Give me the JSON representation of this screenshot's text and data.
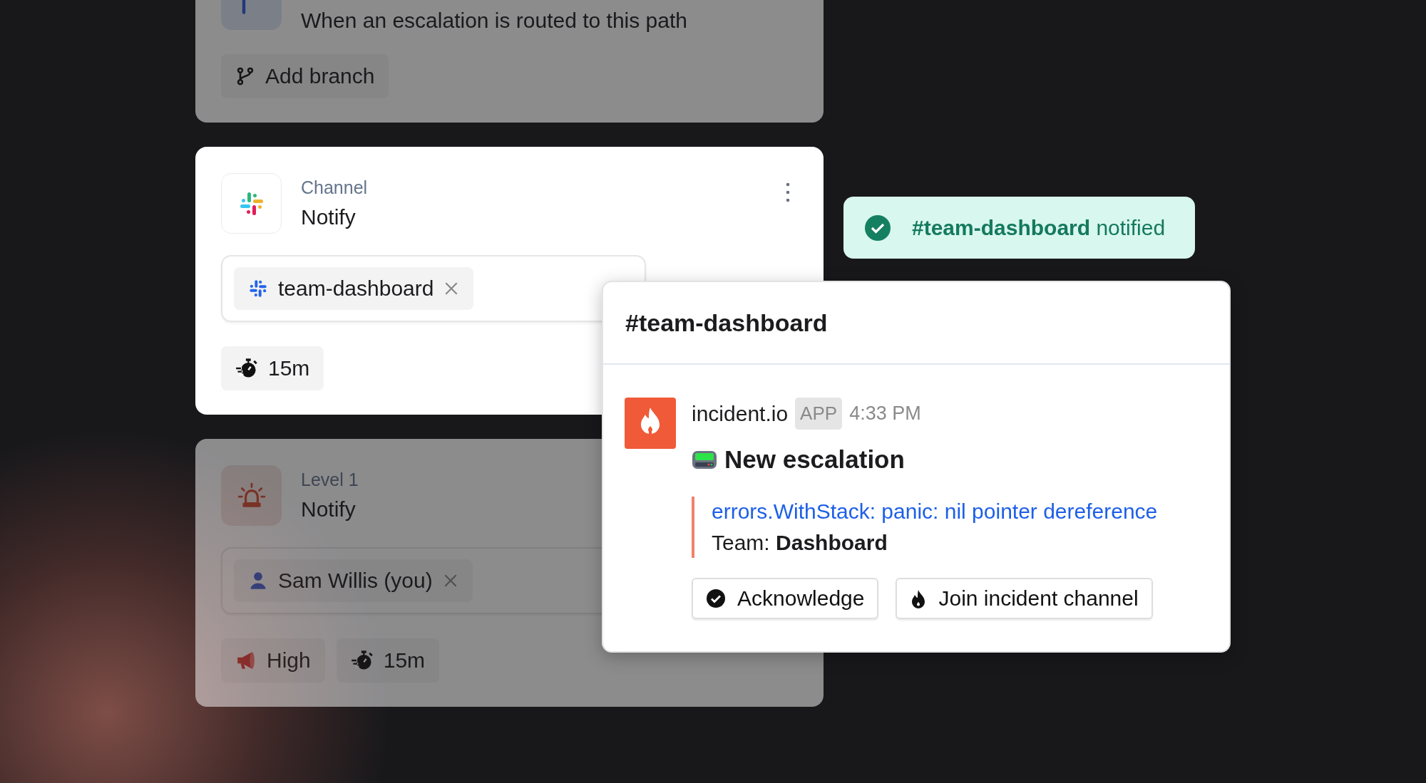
{
  "cards": [
    {
      "kind": "trigger",
      "dimmed": true,
      "title": "When an escalation is routed to this path",
      "actions": [
        {
          "kind": "branch",
          "label": "Add branch"
        }
      ]
    },
    {
      "kind": "channel",
      "dimmed": false,
      "subtitle": "Channel",
      "title": "Notify",
      "chips": [
        {
          "kind": "channel",
          "label": "team-dashboard"
        }
      ],
      "tags": [
        {
          "kind": "delay",
          "label": "15m"
        }
      ]
    },
    {
      "kind": "level",
      "dimmed": true,
      "subtitle": "Level 1",
      "title": "Notify",
      "chips": [
        {
          "kind": "person",
          "label": "Sam Willis (you)"
        }
      ],
      "tags": [
        {
          "kind": "priority",
          "label": "High"
        },
        {
          "kind": "delay",
          "label": "15m"
        }
      ]
    }
  ],
  "toast": {
    "text": "**#team-dashboard** notified"
  },
  "message_popup": {
    "channel": "#team-dashboard",
    "sender": "incident.io",
    "badge": "APP",
    "time": "4:33 PM",
    "title": "New escalation",
    "link": "errors.WithStack: panic: nil pointer dereference",
    "field": "Team: **Dashboard**",
    "buttons": [
      {
        "kind": "acknowledge",
        "label": "Acknowledge"
      },
      {
        "kind": "join",
        "label": "Join incident channel"
      }
    ]
  }
}
